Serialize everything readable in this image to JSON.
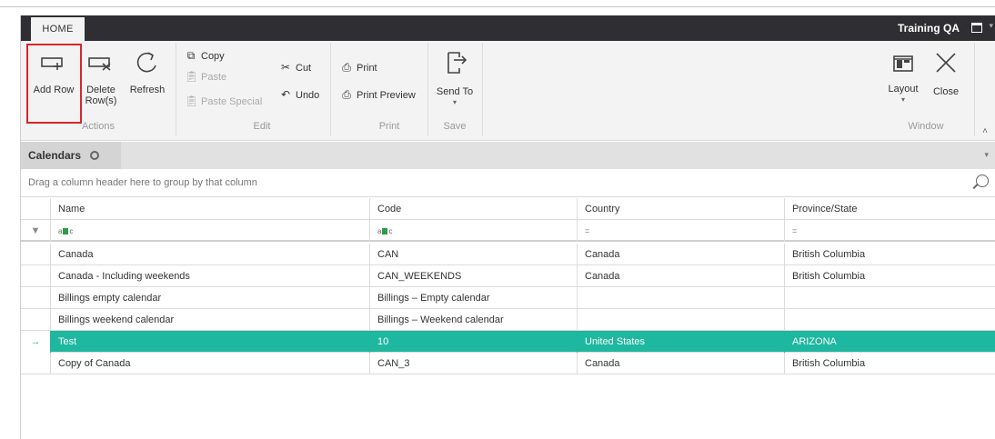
{
  "titlebar": {
    "home_tab": "HOME",
    "app_title": "Training QA"
  },
  "ribbon": {
    "actions": {
      "add_row": "Add Row",
      "delete_rows_line1": "Delete",
      "delete_rows_line2": "Row(s)",
      "refresh": "Refresh",
      "group_label": "Actions"
    },
    "edit": {
      "copy": "Copy",
      "paste": "Paste",
      "paste_special": "Paste Special",
      "cut": "Cut",
      "undo": "Undo",
      "group_label": "Edit"
    },
    "print": {
      "print": "Print",
      "print_preview": "Print Preview",
      "group_label": "Print"
    },
    "save": {
      "send_to": "Send To",
      "group_label": "Save"
    },
    "window": {
      "layout": "Layout",
      "close": "Close",
      "group_label": "Window"
    }
  },
  "doc_tab": {
    "label": "Calendars"
  },
  "group_panel": {
    "hint": "Drag a column header here to group by that column"
  },
  "grid": {
    "columns": [
      "Name",
      "Code",
      "Country",
      "Province/State"
    ],
    "filter_row": {
      "text_filter": "a",
      "text_filter_suffix": "c",
      "equals_filter": "="
    },
    "rows": [
      {
        "name": "Canada",
        "code": "CAN",
        "country": "Canada",
        "province": "British Columbia",
        "selected": false
      },
      {
        "name": "Canada - Including weekends",
        "code": "CAN_WEEKENDS",
        "country": "Canada",
        "province": "British Columbia",
        "selected": false
      },
      {
        "name": "Billings empty calendar",
        "code": "Billings – Empty calendar",
        "country": "",
        "province": "",
        "selected": false
      },
      {
        "name": "Billings weekend calendar",
        "code": "Billings – Weekend calendar",
        "country": "",
        "province": "",
        "selected": false
      },
      {
        "name": "Test",
        "code": "10",
        "country": "United States",
        "province": "ARIZONA",
        "selected": true
      },
      {
        "name": "Copy of Canada",
        "code": "CAN_3",
        "country": "Canada",
        "province": "British Columbia",
        "selected": false
      }
    ]
  },
  "colors": {
    "accent": "#1eb79f",
    "titlebar": "#2e2e33",
    "highlight": "#d9262b"
  }
}
